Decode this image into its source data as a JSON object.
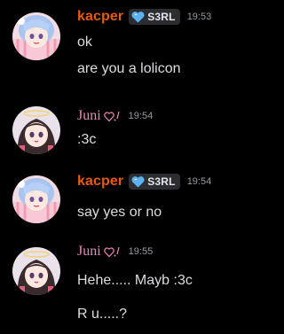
{
  "messages": [
    {
      "author": "kacper",
      "tag": "S3RL",
      "time": "19:53",
      "lines": [
        "ok",
        "are you a lolicon"
      ]
    },
    {
      "author": "Juni",
      "time": "19:54",
      "lines": [
        ":3c"
      ]
    },
    {
      "author": "kacper",
      "tag": "S3RL",
      "time": "19:54",
      "lines": [
        "say yes or no"
      ]
    },
    {
      "author": "Juni",
      "time": "19:55",
      "lines": [
        "Hehe..... Mayb :3c",
        "R u.....?"
      ]
    }
  ],
  "colors": {
    "background": "#000000",
    "kacper_name": "#e8590c",
    "juni_name": "#ef86b8",
    "timestamp": "#949ba4",
    "message_text": "#dbdee1",
    "tag_background": "#2b2d31",
    "tag_icon": "#5ab2f2"
  },
  "icons": {
    "tag_icon": "blue-heart-icon",
    "juni_decoration": "heart-outline-sparkle-icon"
  }
}
